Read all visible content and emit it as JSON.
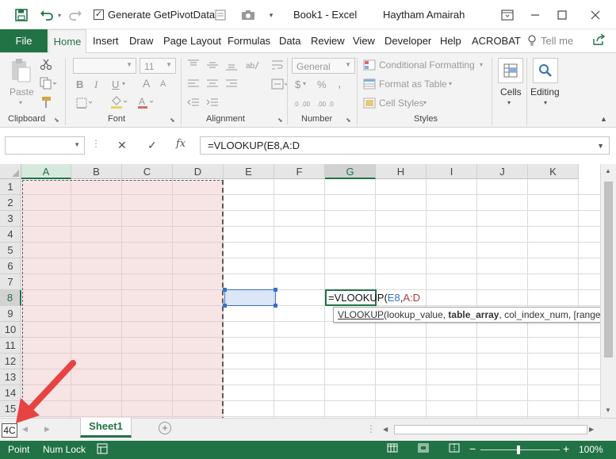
{
  "titlebar": {
    "save_icon": "save-icon",
    "undo_icon": "undo-icon",
    "redo_icon": "redo-icon",
    "generate_pivot_checked": true,
    "generate_pivot_label": "Generate GetPivotData",
    "title": "Book1  -  Excel",
    "user": "Haytham Amairah"
  },
  "ribbon_tabs": {
    "file": "File",
    "home": "Home",
    "insert": "Insert",
    "draw": "Draw",
    "page_layout": "Page Layout",
    "formulas": "Formulas",
    "data": "Data",
    "review": "Review",
    "view": "View",
    "developer": "Developer",
    "help": "Help",
    "acrobat": "ACROBAT",
    "tell_me": "Tell me"
  },
  "ribbon": {
    "clipboard": {
      "label": "Clipboard",
      "paste": "Paste"
    },
    "font": {
      "label": "Font",
      "font_name": "",
      "font_size": "11",
      "bold": "B",
      "italic": "I",
      "underline": "U",
      "grow": "A",
      "shrink": "A"
    },
    "alignment": {
      "label": "Alignment"
    },
    "number": {
      "label": "Number",
      "format": "General",
      "currency": "$",
      "percent": "%",
      "comma": ","
    },
    "styles": {
      "label": "Styles",
      "conditional_formatting": "Conditional Formatting",
      "format_as_table": "Format as Table",
      "cell_styles": "Cell Styles"
    },
    "cells": {
      "label": "Cells"
    },
    "editing": {
      "label": "Editing"
    }
  },
  "formula_bar": {
    "name_box": "",
    "cancel": "✕",
    "enter": "✓",
    "fx": "fx",
    "formula": "=VLOOKUP(E8,A:D"
  },
  "grid": {
    "columns": [
      "A",
      "B",
      "C",
      "D",
      "E",
      "F",
      "G",
      "H",
      "I",
      "J",
      "K"
    ],
    "rows": [
      "1",
      "2",
      "3",
      "4",
      "5",
      "6",
      "7",
      "8",
      "9",
      "10",
      "11",
      "12",
      "13",
      "14",
      "15"
    ],
    "active_cell": "G8",
    "active_cell_formula": {
      "prefix": "=VLOOKUP(",
      "ref1": "E8",
      "comma": ",",
      "ref2": "A:D"
    },
    "tooltip": {
      "fn_name": "VLOOKUP",
      "open": "(lookup_value, ",
      "current_arg": "table_array",
      "rest": ", col_index_num, [range_lookup])"
    }
  },
  "sheet_tabs": {
    "reference_box": "4C",
    "sheets": [
      "Sheet1"
    ],
    "active": "Sheet1"
  },
  "status_bar": {
    "mode": "Point",
    "num_lock": "Num Lock",
    "zoom": "100%"
  },
  "colors": {
    "excel_green": "#217346",
    "range_dash": "#5a5a5a",
    "ref_blue": "#3a6fd0",
    "ref_red": "#b23b3b",
    "annotation_red": "#e84343"
  }
}
